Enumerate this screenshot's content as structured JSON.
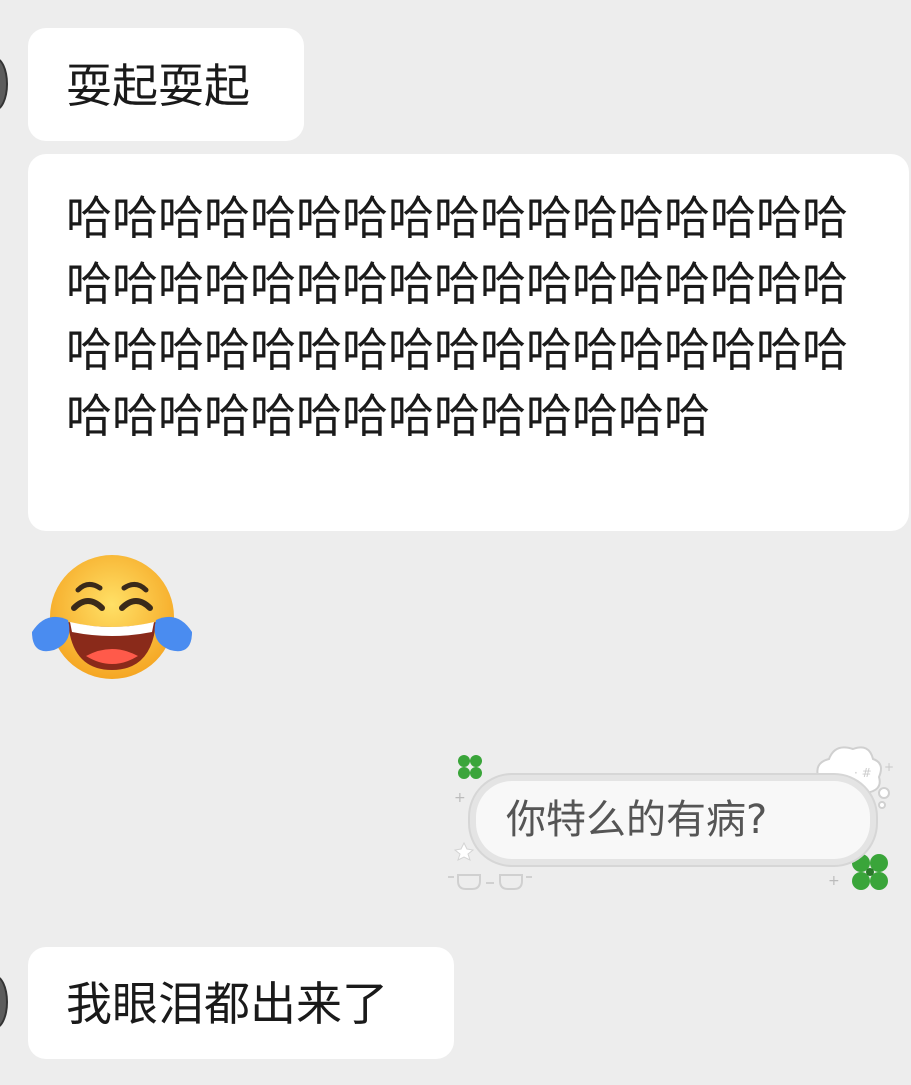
{
  "messages": [
    {
      "side": "left",
      "type": "text",
      "text": "耍起耍起"
    },
    {
      "side": "left",
      "type": "text",
      "text": "哈哈哈哈哈哈哈哈哈哈哈哈哈哈哈哈哈哈哈哈哈哈哈哈哈哈哈哈哈哈哈哈哈哈哈哈哈哈哈哈哈哈哈哈哈哈哈哈哈哈哈哈哈哈哈哈哈哈哈哈哈哈哈哈哈"
    },
    {
      "side": "left",
      "type": "emoji",
      "icon": "tears-of-joy-emoji"
    },
    {
      "side": "right",
      "type": "sticker",
      "text": "你特么的有病?",
      "icon": "cloud-bubble-sticker"
    },
    {
      "side": "left",
      "type": "text",
      "text": "我眼泪都出来了"
    }
  ],
  "colors": {
    "chat_background": "#ededed",
    "bubble_background": "#ffffff",
    "text": "#1a1a1a",
    "sticker_text": "#555555",
    "clover_green": "#3aa53a"
  }
}
